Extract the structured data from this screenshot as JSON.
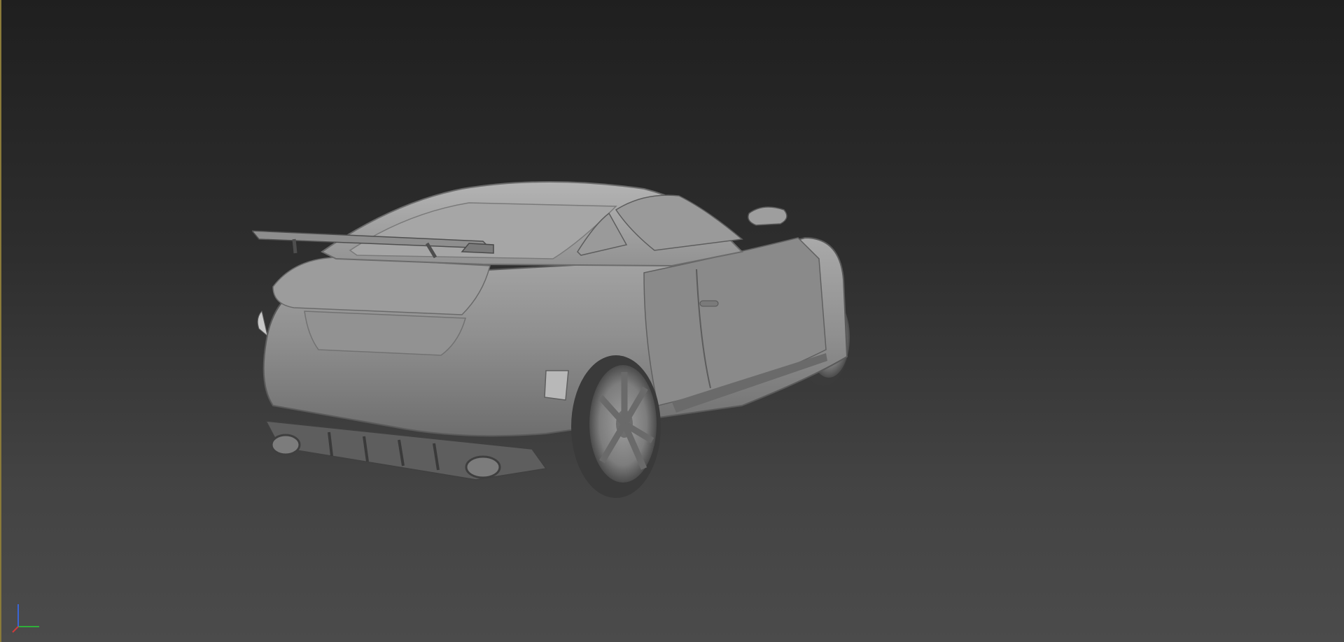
{
  "viewport": {
    "background_top": "#1f1f1f",
    "background_bottom": "#4b4b4b",
    "border_color": "#8a7a3a"
  },
  "model": {
    "icon": "car-model"
  },
  "axis_gizmo": {
    "x_color": "#2fae3a",
    "y_color": "#3a66d6",
    "z_color": "#d23a3a"
  }
}
